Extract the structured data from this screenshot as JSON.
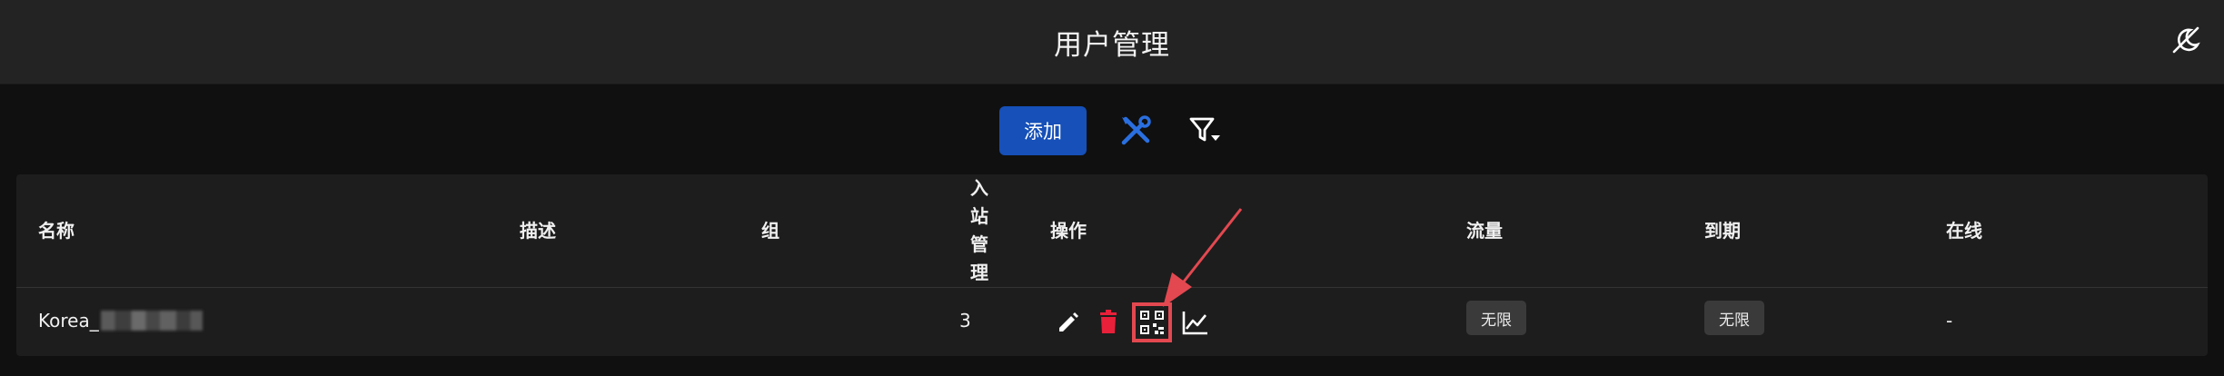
{
  "header": {
    "title": "用户管理",
    "theme_icon": "theme-toggle-icon"
  },
  "toolbar": {
    "add_label": "添加",
    "tools_icon": "tools-icon",
    "filter_icon": "filter-icon"
  },
  "table": {
    "columns": {
      "name": "名称",
      "description": "描述",
      "group": "组",
      "inbound": [
        "入",
        "站",
        "管",
        "理"
      ],
      "actions": "操作",
      "traffic": "流量",
      "expiry": "到期",
      "online": "在线"
    },
    "rows": [
      {
        "name": "Korea_",
        "description": "",
        "group": "",
        "inbound": "3",
        "traffic": "无限",
        "expiry": "无限",
        "online": "-"
      }
    ]
  },
  "colors": {
    "accent": "#1650b8",
    "delete": "#e8203a",
    "highlight": "#e34850"
  }
}
